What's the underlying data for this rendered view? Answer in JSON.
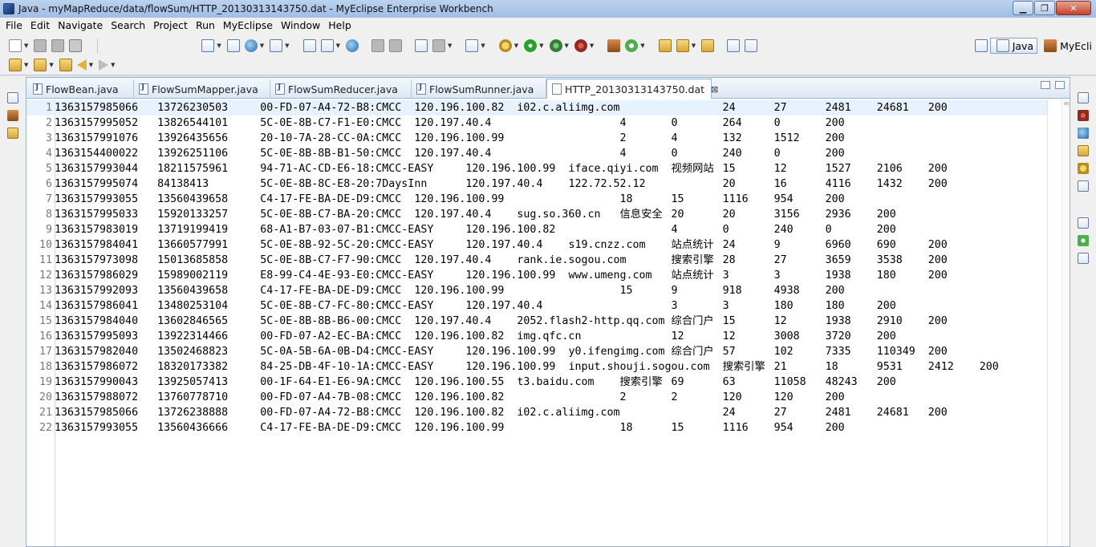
{
  "window": {
    "title": "Java - myMapReduce/data/flowSum/HTTP_20130313143750.dat - MyEclipse Enterprise Workbench"
  },
  "menu": [
    "File",
    "Edit",
    "Navigate",
    "Search",
    "Project",
    "Run",
    "MyEclipse",
    "Window",
    "Help"
  ],
  "perspectives": {
    "java": "Java",
    "myeclipse": "MyEcli"
  },
  "tabs": [
    {
      "label": "FlowBean.java"
    },
    {
      "label": "FlowSumMapper.java"
    },
    {
      "label": "FlowSumReducer.java"
    },
    {
      "label": "FlowSumRunner.java"
    },
    {
      "label": "HTTP_20130313143750.dat",
      "close": "⊠"
    }
  ],
  "lines": [
    "1363157985066\t13726230503\t00-FD-07-A4-72-B8:CMCC\t120.196.100.82\ti02.c.aliimg.com\t\t24\t27\t2481\t24681\t200",
    "1363157995052\t13826544101\t5C-0E-8B-C7-F1-E0:CMCC\t120.197.40.4\t\t\t4\t0\t264\t0\t200",
    "1363157991076\t13926435656\t20-10-7A-28-CC-0A:CMCC\t120.196.100.99\t\t\t2\t4\t132\t1512\t200",
    "1363154400022\t13926251106\t5C-0E-8B-8B-B1-50:CMCC\t120.197.40.4\t\t\t4\t0\t240\t0\t200",
    "1363157993044\t18211575961\t94-71-AC-CD-E6-18:CMCC-EASY\t120.196.100.99\tiface.qiyi.com\t视频网站\t15\t12\t1527\t2106\t200",
    "1363157995074\t84138413\t5C-0E-8B-8C-E8-20:7DaysInn\t120.197.40.4\t122.72.52.12\t\t20\t16\t4116\t1432\t200",
    "1363157993055\t13560439658\tC4-17-FE-BA-DE-D9:CMCC\t120.196.100.99\t\t\t18\t15\t1116\t954\t200",
    "1363157995033\t15920133257\t5C-0E-8B-C7-BA-20:CMCC\t120.197.40.4\tsug.so.360.cn\t信息安全\t20\t20\t3156\t2936\t200",
    "1363157983019\t13719199419\t68-A1-B7-03-07-B1:CMCC-EASY\t120.196.100.82\t\t\t4\t0\t240\t0\t200",
    "1363157984041\t13660577991\t5C-0E-8B-92-5C-20:CMCC-EASY\t120.197.40.4\ts19.cnzz.com\t站点统计\t24\t9\t6960\t690\t200",
    "1363157973098\t15013685858\t5C-0E-8B-C7-F7-90:CMCC\t120.197.40.4\trank.ie.sogou.com\t搜索引擎\t28\t27\t3659\t3538\t200",
    "1363157986029\t15989002119\tE8-99-C4-4E-93-E0:CMCC-EASY\t120.196.100.99\twww.umeng.com\t站点统计\t3\t3\t1938\t180\t200",
    "1363157992093\t13560439658\tC4-17-FE-BA-DE-D9:CMCC\t120.196.100.99\t\t\t15\t9\t918\t4938\t200",
    "1363157986041\t13480253104\t5C-0E-8B-C7-FC-80:CMCC-EASY\t120.197.40.4\t\t\t3\t3\t180\t180\t200",
    "1363157984040\t13602846565\t5C-0E-8B-8B-B6-00:CMCC\t120.197.40.4\t2052.flash2-http.qq.com\t综合门户\t15\t12\t1938\t2910\t200",
    "1363157995093\t13922314466\t00-FD-07-A2-EC-BA:CMCC\t120.196.100.82\timg.qfc.cn\t\t12\t12\t3008\t3720\t200",
    "1363157982040\t13502468823\t5C-0A-5B-6A-0B-D4:CMCC-EASY\t120.196.100.99\ty0.ifengimg.com\t综合门户\t57\t102\t7335\t110349\t200",
    "1363157986072\t18320173382\t84-25-DB-4F-10-1A:CMCC-EASY\t120.196.100.99\tinput.shouji.sogou.com\t搜索引擎\t21\t18\t9531\t2412\t200",
    "1363157990043\t13925057413\t00-1F-64-E1-E6-9A:CMCC\t120.196.100.55\tt3.baidu.com\t搜索引擎\t69\t63\t11058\t48243\t200",
    "1363157988072\t13760778710\t00-FD-07-A4-7B-08:CMCC\t120.196.100.82\t\t\t2\t2\t120\t120\t200",
    "1363157985066\t13726238888\t00-FD-07-A4-72-B8:CMCC\t120.196.100.82\ti02.c.aliimg.com\t\t24\t27\t2481\t24681\t200",
    "1363157993055\t13560436666\tC4-17-FE-BA-DE-D9:CMCC\t120.196.100.99\t\t\t18\t15\t1116\t954\t200"
  ],
  "line_numbers": [
    "1",
    "2",
    "3",
    "4",
    "5",
    "6",
    "7",
    "8",
    "9",
    "10",
    "11",
    "12",
    "13",
    "14",
    "15",
    "16",
    "17",
    "18",
    "19",
    "20",
    "21",
    "22"
  ],
  "colors": {
    "accent": "#99b4d1",
    "current_line": "#e8f2fe",
    "line_number": "#787878"
  }
}
